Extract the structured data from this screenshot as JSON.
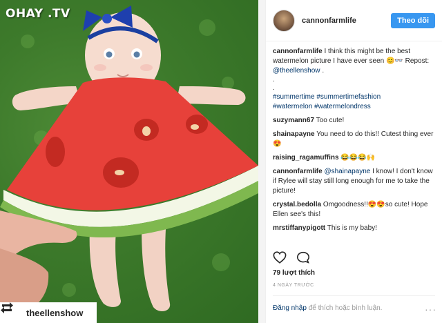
{
  "watermark": "OHAY .TV",
  "repost": {
    "handle": "theellenshow"
  },
  "header": {
    "username": "cannonfarmlife",
    "follow_label": "Theo dõi"
  },
  "caption": {
    "username": "cannonfarmlife",
    "text": "I think this might be the best watermelon picture I have ever seen 😊👓",
    "repost_prefix": "Repost:",
    "repost_handle": "@theellenshow",
    "repost_suffix": ".",
    "dots": [
      ".",
      "."
    ],
    "hashtags_line1": [
      "#summertime",
      "#summertimefashion"
    ],
    "hashtags_line2": [
      "#watermelon",
      "#watermelondress"
    ]
  },
  "comments": [
    {
      "user": "suzymann67",
      "text": "Too cute!"
    },
    {
      "user": "shainapayne",
      "text": "You need to do this!! Cutest thing ever😍"
    },
    {
      "user": "raising_ragamuffins",
      "text": "😂😂😂🙌"
    },
    {
      "user": "cannonfarmlife",
      "mention": "@shainapayne",
      "text": " I know! I don't know if Rylee will stay still long enough for me to take the picture!"
    },
    {
      "user": "crystal.bedolla",
      "text": "Omgoodness!!😍😍so cute! Hope Ellen see's this!"
    },
    {
      "user": "mrstiffanypigott",
      "text": "This is my baby!"
    }
  ],
  "likes": "79 lượt thích",
  "timestamp": "4 NGÀY TRƯỚC",
  "login": {
    "link": "Đăng nhập",
    "rest": " để thích hoặc bình luận."
  },
  "more": "···",
  "icons": {
    "like": "heart-icon",
    "comment": "comment-icon",
    "repost": "repost-icon"
  },
  "colors": {
    "follow": "#3897f0",
    "hashtag": "#003569",
    "muted": "#999999"
  }
}
